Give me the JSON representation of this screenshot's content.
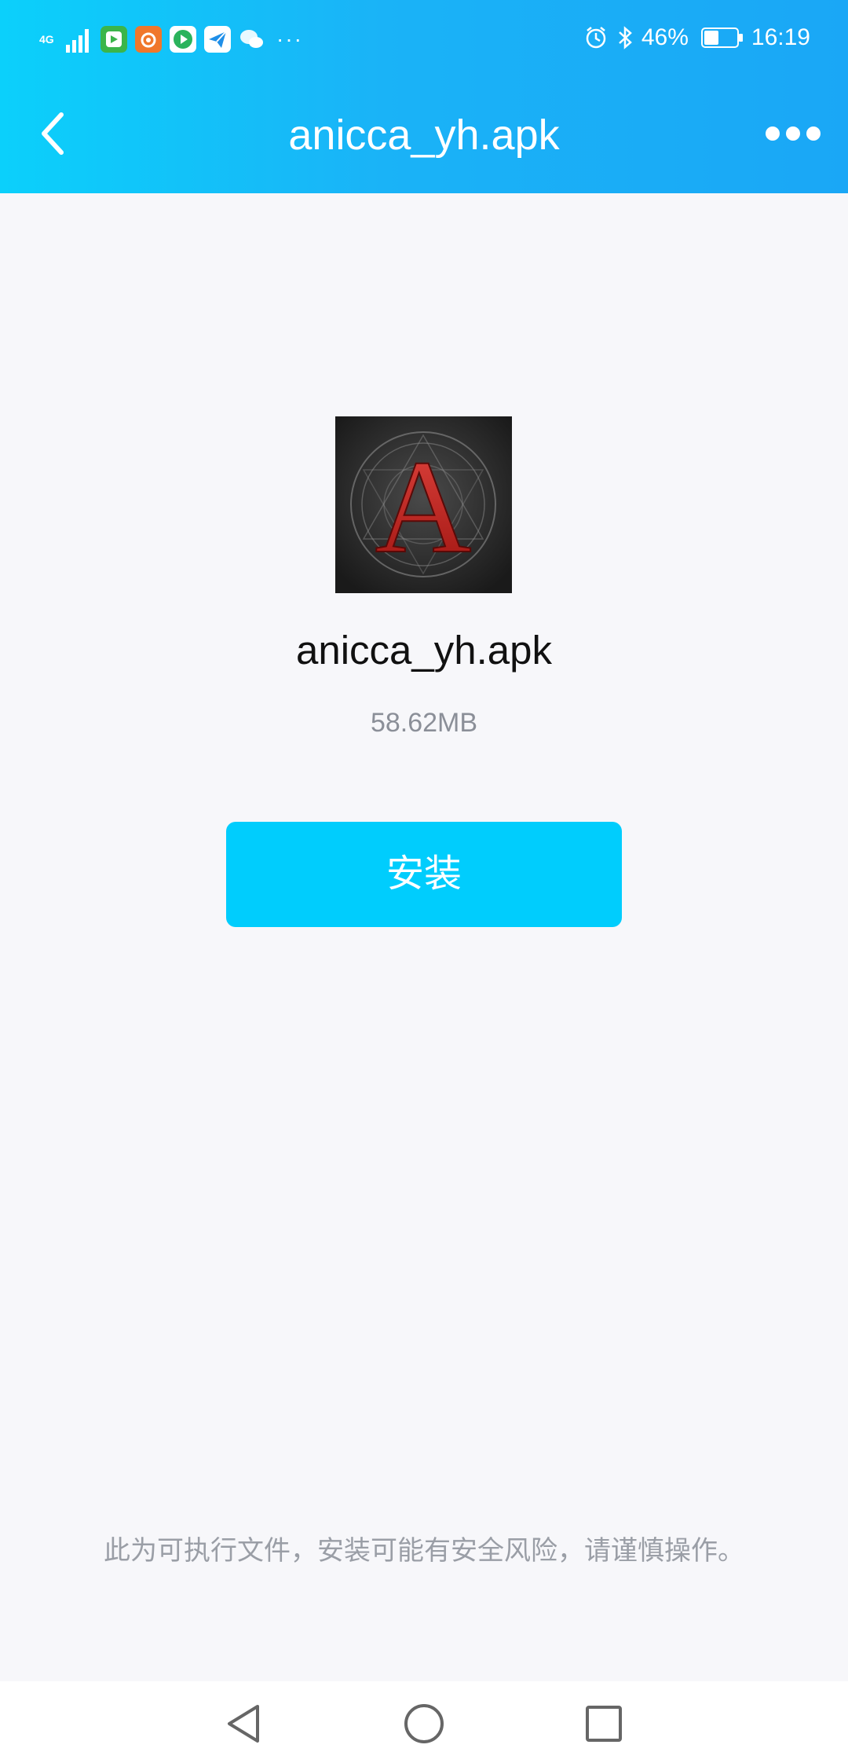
{
  "status_bar": {
    "network_label": "4G",
    "apps": [
      {
        "icon": "game-center-icon",
        "label": "",
        "color": "#3bb54a"
      },
      {
        "icon": "uc-browser-icon",
        "label": "",
        "color": "#f0772b"
      },
      {
        "icon": "video-player-icon",
        "label": "",
        "color": "#ffffff"
      },
      {
        "icon": "paper-plane-icon",
        "label": "",
        "color": "#ffffff"
      },
      {
        "icon": "wechat-icon",
        "label": "",
        "color": "#ffffff"
      }
    ],
    "more": "···",
    "battery_percent": "46%",
    "battery_level": 0.46,
    "time": "16:19"
  },
  "title_bar": {
    "title": "anicca_yh.apk",
    "gradient_start": "#0bd0fb",
    "gradient_end": "#1aa7f6"
  },
  "file": {
    "name": "anicca_yh.apk",
    "size": "58.62MB",
    "icon": "app-logo-letter-a-icon",
    "icon_letter": "A"
  },
  "install_button": {
    "label": "安装",
    "color": "#00cdfd"
  },
  "risk_note": "此为可执行文件，安装可能有安全风险，请谨慎操作。",
  "nav_bar": {
    "back": "back-triangle-icon",
    "home": "home-circle-icon",
    "recent": "recent-square-icon"
  }
}
